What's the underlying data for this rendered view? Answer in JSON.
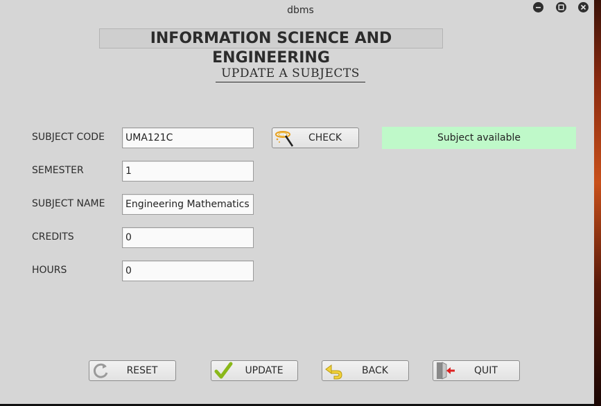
{
  "window": {
    "title": "dbms"
  },
  "header": {
    "title": "INFORMATION SCIENCE AND ENGINEERING",
    "subtitle": "UPDATE A SUBJECTS"
  },
  "form": {
    "subject_code": {
      "label": "SUBJECT CODE",
      "value": "UMA121C"
    },
    "semester": {
      "label": "SEMESTER",
      "value": "1"
    },
    "subject_name": {
      "label": "SUBJECT NAME",
      "value": "Engineering Mathematics I"
    },
    "credits": {
      "label": "CREDITS",
      "value": "0"
    },
    "hours": {
      "label": "HOURS",
      "value": "0"
    }
  },
  "check_button": {
    "label": "CHECK",
    "icon": "magic-wand-icon"
  },
  "status": {
    "text": "Subject available",
    "color": "#bff9c9"
  },
  "actions": {
    "reset": {
      "label": "RESET",
      "icon": "refresh-icon"
    },
    "update": {
      "label": "UPDATE",
      "icon": "checkmark-icon"
    },
    "back": {
      "label": "BACK",
      "icon": "back-arrow-icon"
    },
    "quit": {
      "label": "QUIT",
      "icon": "exit-door-icon"
    }
  }
}
